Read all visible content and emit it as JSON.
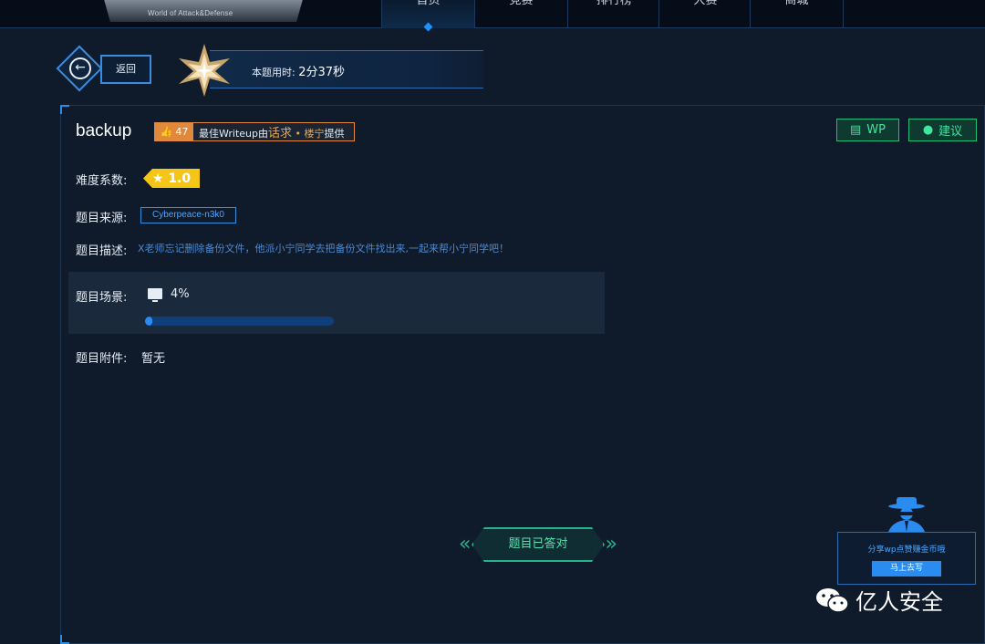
{
  "nav": {
    "logo_sub": "World of Attack&Defense",
    "items": [
      {
        "label": "首页"
      },
      {
        "label": "竞赛"
      },
      {
        "label": "排行榜"
      },
      {
        "label": "大赛"
      },
      {
        "label": "商城"
      }
    ]
  },
  "back": {
    "label": "返回"
  },
  "timer": {
    "label": "本题用时:",
    "value": "2分37秒"
  },
  "challenge": {
    "title": "backup",
    "likes": "47",
    "wp_prefix": "最佳Writeup由",
    "wp_author": "话求",
    "wp_dot": " • 楼宁",
    "wp_suffix": "提供",
    "wp_button": "WP",
    "suggest_button": "建议",
    "difficulty_label": "难度系数:",
    "difficulty_value": "1.0",
    "source_label": "题目来源:",
    "source_value": "Cyberpeace-n3k0",
    "desc_label": "题目描述:",
    "desc_value": "X老师忘记删除备份文件，他派小宁同学去把备份文件找出来,一起来帮小宁同学吧！",
    "scene_label": "题目场景:",
    "scene_percent_text": "4%",
    "scene_progress": 0.04,
    "attach_label": "题目附件:",
    "attach_value": "暂无",
    "answered_label": "题目已答对"
  },
  "share": {
    "text": "分享wp点赞赚金币哦",
    "button": "马上去写"
  },
  "watermark": {
    "text": "亿人安全"
  },
  "colors": {
    "accent": "#2a8bf0",
    "success": "#27b389",
    "warning": "#f5c518",
    "orange": "#e0883b"
  }
}
